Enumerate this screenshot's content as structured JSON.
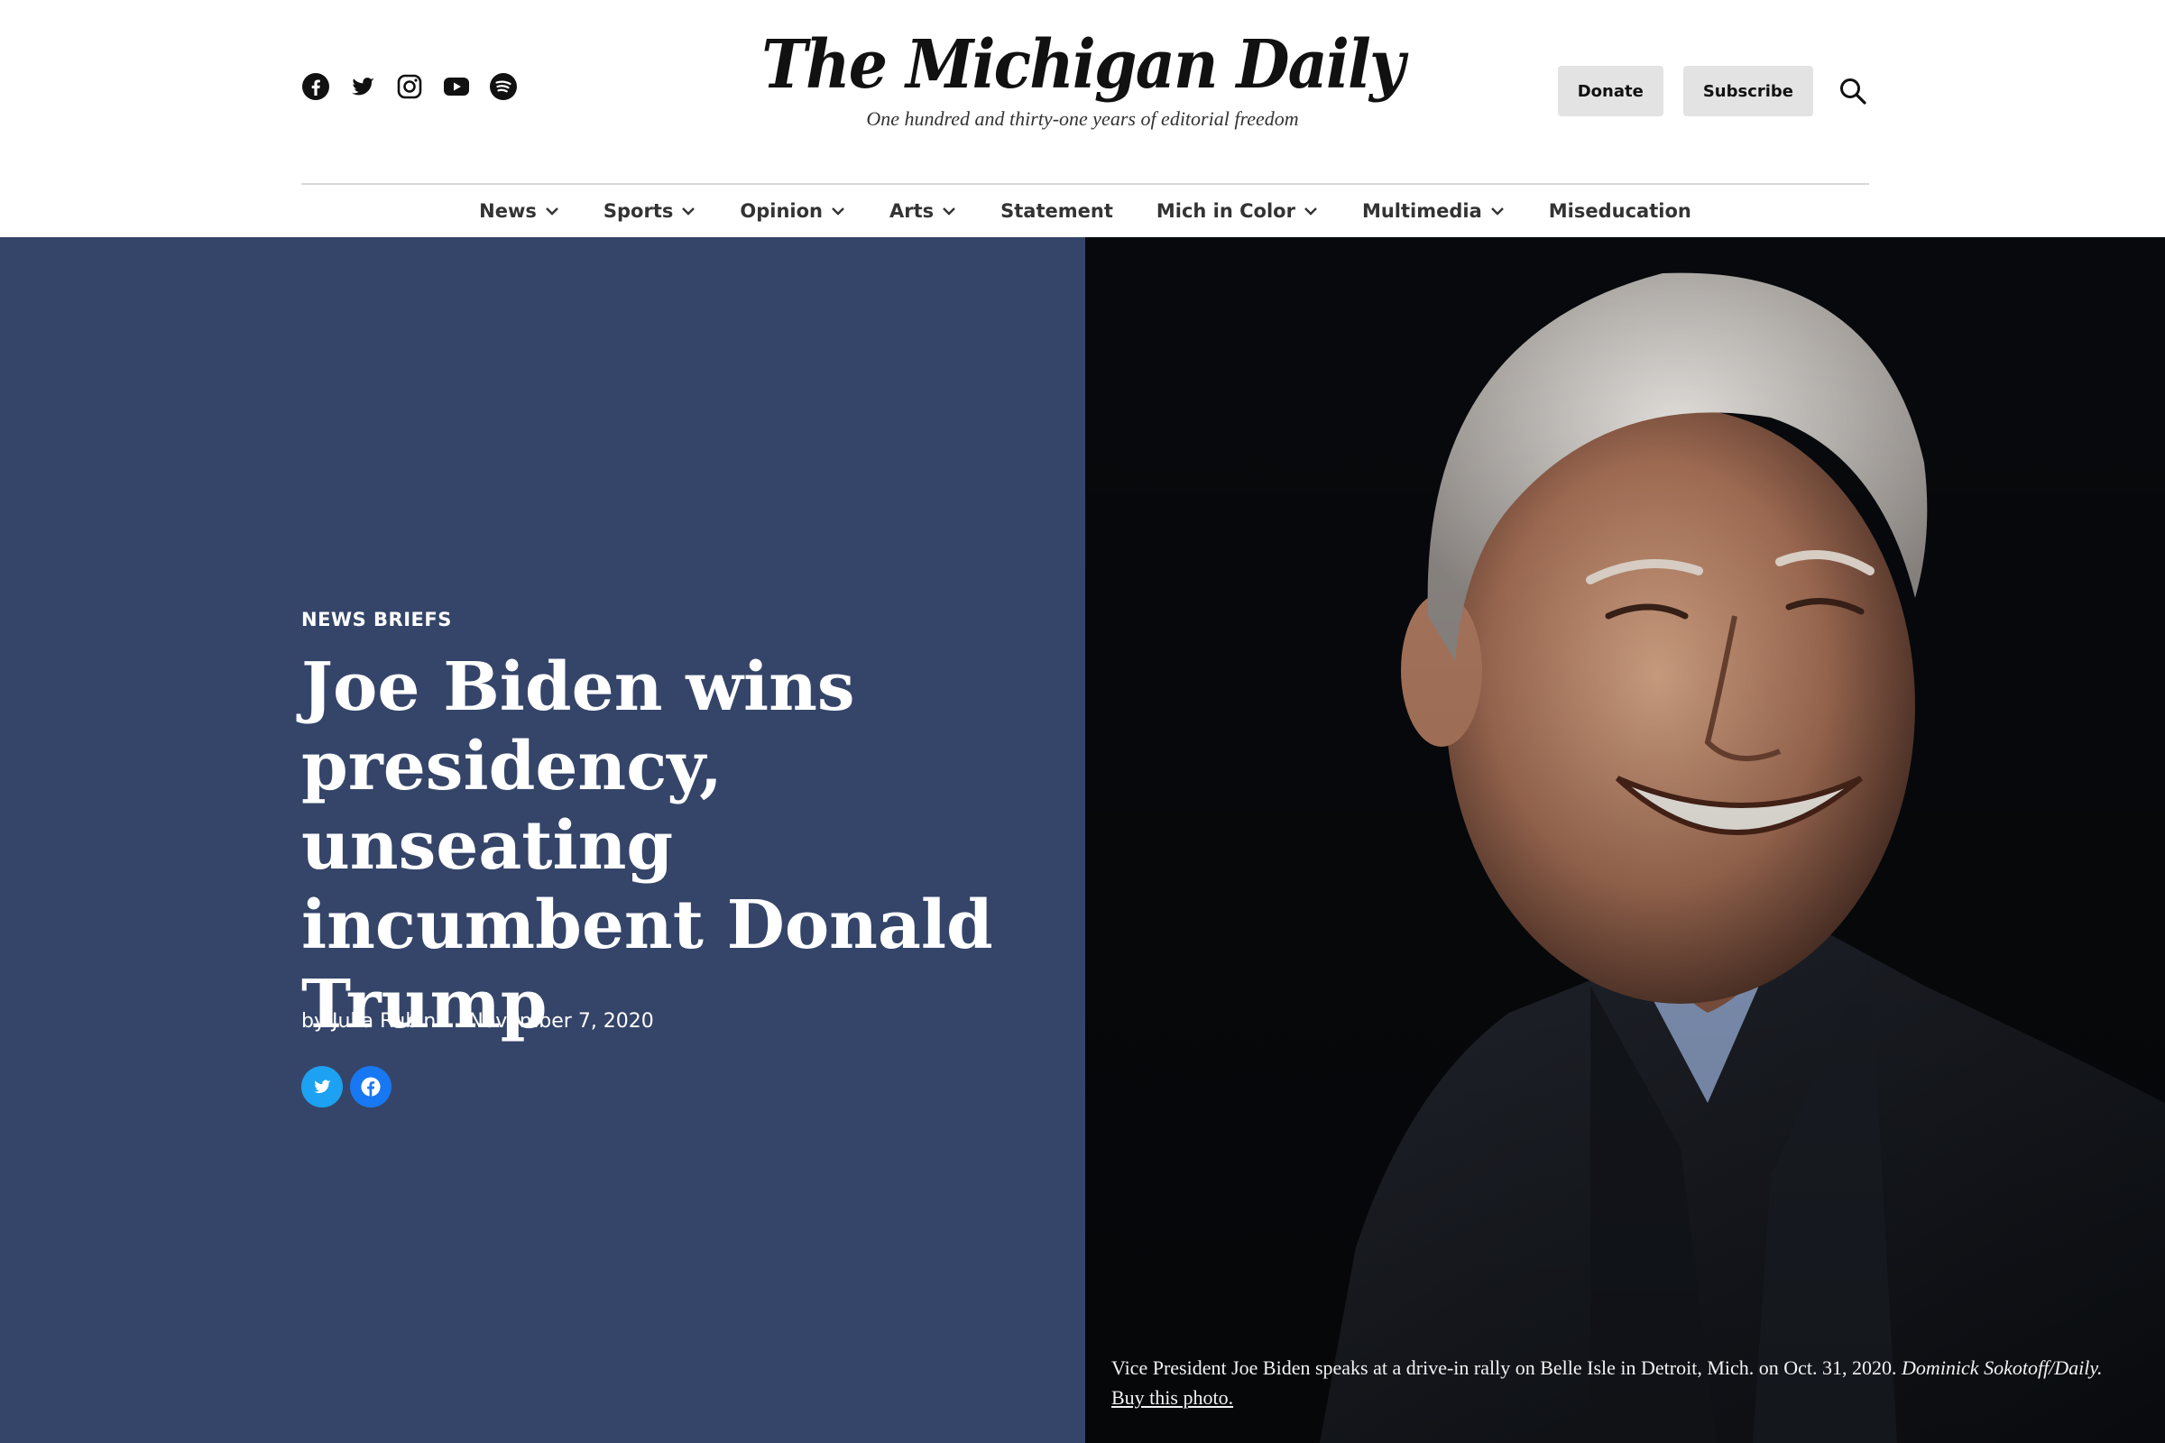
{
  "header": {
    "logo": "The Michigan Daily",
    "tagline": "One hundred and thirty-one years of editorial freedom",
    "social_icons": [
      "facebook-icon",
      "twitter-icon",
      "instagram-icon",
      "youtube-icon",
      "spotify-icon"
    ],
    "donate_label": "Donate",
    "subscribe_label": "Subscribe",
    "search_icon": "search-icon"
  },
  "nav": {
    "items": [
      {
        "label": "News",
        "dropdown": true
      },
      {
        "label": "Sports",
        "dropdown": true
      },
      {
        "label": "Opinion",
        "dropdown": true
      },
      {
        "label": "Arts",
        "dropdown": true
      },
      {
        "label": "Statement",
        "dropdown": false
      },
      {
        "label": "Mich in Color",
        "dropdown": true
      },
      {
        "label": "Multimedia",
        "dropdown": true
      },
      {
        "label": "Miseducation",
        "dropdown": false
      }
    ]
  },
  "article": {
    "category": "NEWS BRIEFS",
    "headline": "Joe Biden wins presidency, unseating incumbent Donald Trump",
    "byline": "by Julia Rubin",
    "date": "November 7, 2020",
    "share_icons": [
      "twitter-icon",
      "facebook-icon"
    ]
  },
  "photo": {
    "caption": "Vice President Joe Biden speaks at a drive-in rally on Belle Isle in Detroit, Mich. on Oct. 31, 2020.",
    "credit": "Dominick Sokotoff/Daily.",
    "buy_link": "Buy this photo."
  },
  "colors": {
    "hero_panel": "#354569",
    "photo_bg": "#07090c",
    "twitter": "#1da1f2",
    "facebook": "#1877f2"
  }
}
